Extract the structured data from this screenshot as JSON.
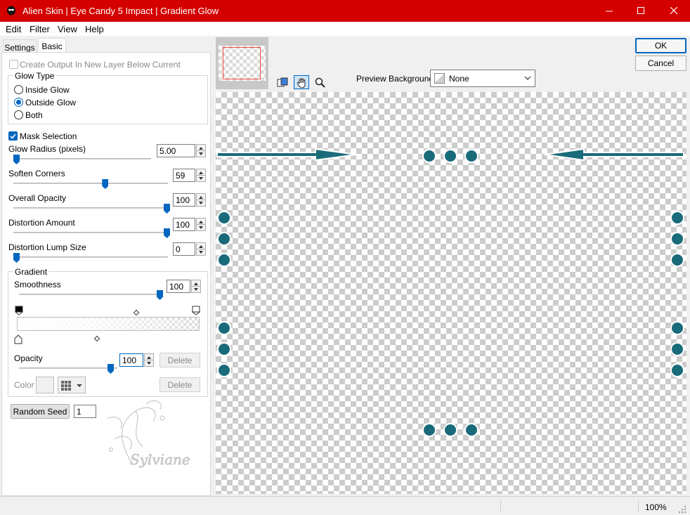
{
  "window": {
    "title": "Alien Skin | Eye Candy 5 Impact | Gradient Glow"
  },
  "menu": [
    "Edit",
    "Filter",
    "View",
    "Help"
  ],
  "tabs": {
    "settings": "Settings",
    "basic": "Basic"
  },
  "basic": {
    "create_output_label": "Create Output In New Layer Below Current",
    "glow_type": {
      "title": "Glow Type",
      "options": [
        "Inside Glow",
        "Outside Glow",
        "Both"
      ],
      "selected": "Outside Glow"
    },
    "mask_selection_label": "Mask Selection",
    "sliders": [
      {
        "label": "Glow Radius (pixels)",
        "value": "5.00",
        "level": 0.0
      },
      {
        "label": "Soften Corners",
        "value": "59",
        "level": 0.59
      },
      {
        "label": "Overall Opacity",
        "value": "100",
        "level": 1.0
      },
      {
        "label": "Distortion Amount",
        "value": "100",
        "level": 1.0
      },
      {
        "label": "Distortion Lump Size",
        "value": "0",
        "level": 0.0
      }
    ],
    "gradient": {
      "title": "Gradient",
      "smoothness_label": "Smoothness",
      "smoothness_value": "100",
      "smoothness_level": 1.0,
      "opacity_label": "Opacity",
      "opacity_value": "100",
      "opacity_level": 1.0,
      "delete_label": "Delete",
      "color_label": "Color",
      "delete_color_label": "Delete"
    },
    "random_seed_label": "Random Seed",
    "random_seed_value": "1"
  },
  "buttons": {
    "ok": "OK",
    "cancel": "Cancel"
  },
  "preview_background": {
    "label": "Preview Background:",
    "value": "None"
  },
  "status": {
    "zoom": "100%"
  },
  "watermark_text": "Sylviane",
  "colors": {
    "titlebar": "#d40000",
    "accent": "#0067c0",
    "dots": "#1a6b7a"
  }
}
